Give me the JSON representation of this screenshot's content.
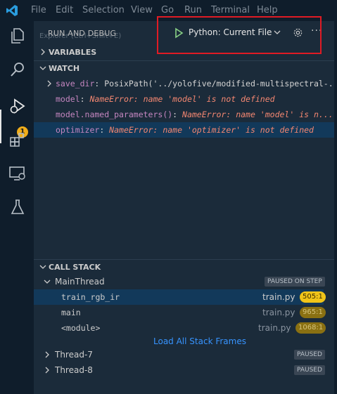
{
  "menu": [
    "File",
    "Edit",
    "Selection",
    "View",
    "Go",
    "Run",
    "Terminal",
    "Help"
  ],
  "activity_badge": "1",
  "panel": {
    "title": "RUN AND DEBUG",
    "tooltip_hint": "Explorer (Ctrl+Shift+E)",
    "configuration": "Python: Current File"
  },
  "sections": {
    "variables": "VARIABLES",
    "watch": "WATCH",
    "call_stack": "CALL STACK"
  },
  "watch": [
    {
      "expr": "save_dir",
      "sep": ": ",
      "value": "PosixPath('../yolofive/modified-multispectral-...",
      "error": false
    },
    {
      "expr": "model",
      "sep": ": ",
      "value": "NameError: name 'model' is not defined",
      "error": true
    },
    {
      "expr": "model.named_parameters()",
      "sep": ": ",
      "value": "NameError: name 'model' is n...",
      "error": true
    },
    {
      "expr": "optimizer",
      "sep": ": ",
      "value": "NameError: name 'optimizer' is not defined",
      "error": true
    }
  ],
  "call_stack": {
    "main_thread": {
      "name": "MainThread",
      "state": "PAUSED ON STEP"
    },
    "frames": [
      {
        "name": "train_rgb_ir",
        "file": "train.py",
        "line": "505:1"
      },
      {
        "name": "main",
        "file": "train.py",
        "line": "965:1"
      },
      {
        "name": "<module>",
        "file": "train.py",
        "line": "1068:1"
      }
    ],
    "load_all": "Load All Stack Frames",
    "threads": [
      {
        "name": "Thread-7",
        "state": "PAUSED"
      },
      {
        "name": "Thread-8",
        "state": "PAUSED"
      }
    ]
  },
  "colors": {
    "accent_highlight": "#e01b24",
    "link": "#3794ff",
    "badge": "#f0ad1a",
    "line_badge_current": "#f0c419",
    "error_text": "#f48771"
  }
}
